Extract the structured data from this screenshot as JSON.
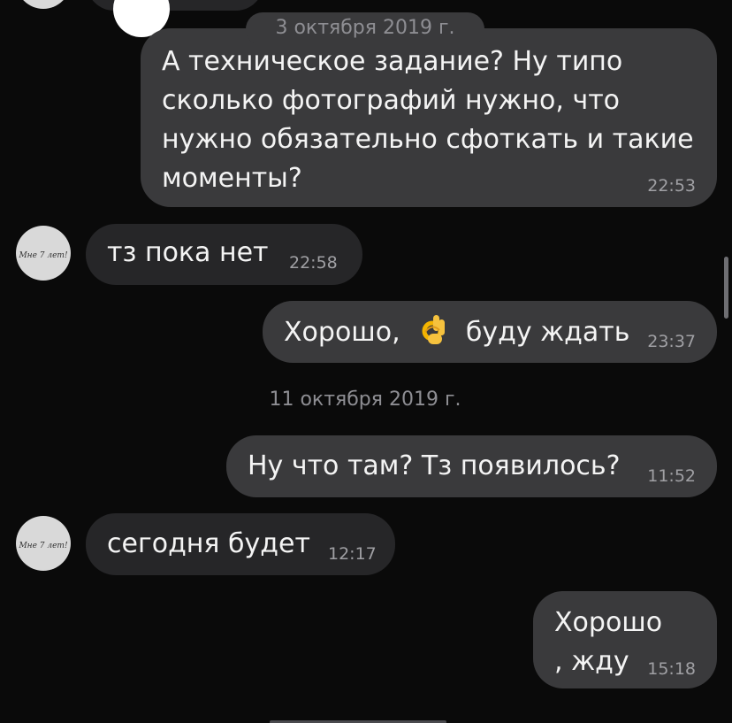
{
  "dates": {
    "first": "3 октября 2019 г.",
    "second": "11 октября 2019 г."
  },
  "messages": [
    {
      "text": "А техническое задание? Ну типо сколько фотографий нужно, что нужно обязательно сфоткать и такие моменты?",
      "time": "22:53",
      "direction": "out"
    },
    {
      "text": "тз пока нет",
      "time": "22:58",
      "direction": "in"
    },
    {
      "text_before": "Хорошо, ",
      "emoji": "ok-hand",
      "text_after": " буду ждать",
      "time": "23:37",
      "direction": "out"
    },
    {
      "text": "Ну что там? Тз появилось?",
      "time": "11:52",
      "direction": "out"
    },
    {
      "text": "сегодня будет",
      "time": "12:17",
      "direction": "in"
    },
    {
      "line1": "Хорошо",
      "line2": ", жду",
      "time": "15:18",
      "direction": "out"
    }
  ],
  "avatar": {
    "signature_text": "Мне 7 лет!"
  },
  "colors": {
    "background": "#0a0a0a",
    "outgoing_bubble": "#3a3a3c",
    "incoming_bubble": "#262628",
    "timestamp": "#a0a0a4",
    "date_text": "#8e8e93"
  }
}
